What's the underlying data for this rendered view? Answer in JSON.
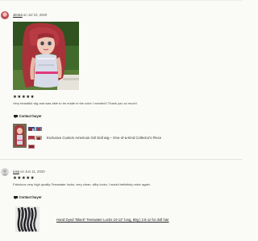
{
  "reviews": [
    {
      "reviewer": "Jenna",
      "date_prefix": "on",
      "date": "Jul 10, 2020",
      "rating_stars": "★★★★★",
      "rating": 5,
      "text": "Very beautiful wig and was able to be made in the color I needed!! Thank you so much!",
      "contact_label": "Contact buyer",
      "product_title": "Exclusive Custom American Girl Doll wig – One-of-a-Kind Collector's Piece"
    },
    {
      "reviewer": "Lisa",
      "date_prefix": "on",
      "date": "Jun 11, 2020",
      "rating_stars": "★★★★★",
      "rating": 5,
      "text": "Fabulous very high quality Teeswater locks, very clean, silky locks, I would definitely order again.",
      "contact_label": "Contact buyer",
      "product_title": "Hand Dyed \"Black\" Teeswater Locks 10-12\" long, 80g | 2.8 oz for doll hair"
    }
  ],
  "icons": {
    "contact": "message-icon",
    "avatar_default": "user-silhouette-icon"
  },
  "colors": {
    "background": "#fafaf7",
    "divider": "#e3e3e3",
    "star": "#111111"
  }
}
